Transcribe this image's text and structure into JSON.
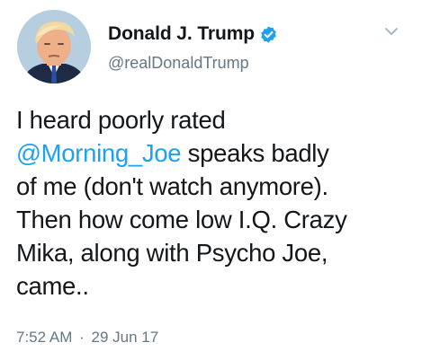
{
  "author": {
    "display_name": "Donald J. Trump",
    "handle": "@realDonaldTrump",
    "verified": true
  },
  "tweet": {
    "lines": [
      {
        "text": "I heard poorly rated"
      },
      {
        "mention": "@Morning_Joe",
        "text": " speaks badly"
      },
      {
        "text": "of me (don't watch anymore)."
      },
      {
        "text": "Then how come low I.Q. Crazy"
      },
      {
        "text": "Mika, along with Psycho Joe,"
      },
      {
        "text": "came.."
      }
    ],
    "time": "7:52 AM",
    "separator": "·",
    "date": "29 Jun 17"
  },
  "icons": {
    "verified": "verified-badge-icon",
    "menu": "chevron-down-icon"
  },
  "colors": {
    "link": "#1da1f2",
    "verified_badge": "#1da1f2",
    "secondary_text": "#657786",
    "primary_text": "#14171a"
  }
}
